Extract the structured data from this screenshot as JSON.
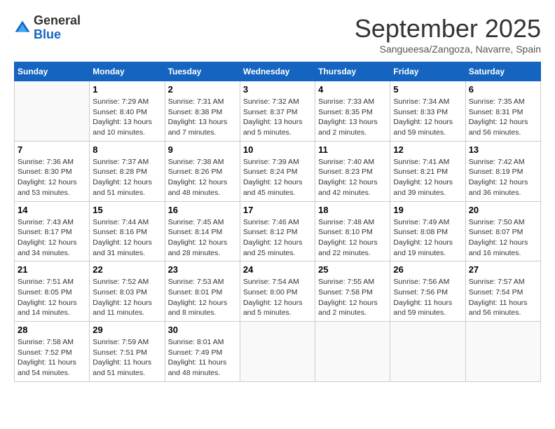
{
  "logo": {
    "general": "General",
    "blue": "Blue"
  },
  "header": {
    "month": "September 2025",
    "location": "Sangueesa/Zangoza, Navarre, Spain"
  },
  "days_of_week": [
    "Sunday",
    "Monday",
    "Tuesday",
    "Wednesday",
    "Thursday",
    "Friday",
    "Saturday"
  ],
  "weeks": [
    [
      {
        "day": "",
        "sunrise": "",
        "sunset": "",
        "daylight": ""
      },
      {
        "day": "1",
        "sunrise": "Sunrise: 7:29 AM",
        "sunset": "Sunset: 8:40 PM",
        "daylight": "Daylight: 13 hours and 10 minutes."
      },
      {
        "day": "2",
        "sunrise": "Sunrise: 7:31 AM",
        "sunset": "Sunset: 8:38 PM",
        "daylight": "Daylight: 13 hours and 7 minutes."
      },
      {
        "day": "3",
        "sunrise": "Sunrise: 7:32 AM",
        "sunset": "Sunset: 8:37 PM",
        "daylight": "Daylight: 13 hours and 5 minutes."
      },
      {
        "day": "4",
        "sunrise": "Sunrise: 7:33 AM",
        "sunset": "Sunset: 8:35 PM",
        "daylight": "Daylight: 13 hours and 2 minutes."
      },
      {
        "day": "5",
        "sunrise": "Sunrise: 7:34 AM",
        "sunset": "Sunset: 8:33 PM",
        "daylight": "Daylight: 12 hours and 59 minutes."
      },
      {
        "day": "6",
        "sunrise": "Sunrise: 7:35 AM",
        "sunset": "Sunset: 8:31 PM",
        "daylight": "Daylight: 12 hours and 56 minutes."
      }
    ],
    [
      {
        "day": "7",
        "sunrise": "Sunrise: 7:36 AM",
        "sunset": "Sunset: 8:30 PM",
        "daylight": "Daylight: 12 hours and 53 minutes."
      },
      {
        "day": "8",
        "sunrise": "Sunrise: 7:37 AM",
        "sunset": "Sunset: 8:28 PM",
        "daylight": "Daylight: 12 hours and 51 minutes."
      },
      {
        "day": "9",
        "sunrise": "Sunrise: 7:38 AM",
        "sunset": "Sunset: 8:26 PM",
        "daylight": "Daylight: 12 hours and 48 minutes."
      },
      {
        "day": "10",
        "sunrise": "Sunrise: 7:39 AM",
        "sunset": "Sunset: 8:24 PM",
        "daylight": "Daylight: 12 hours and 45 minutes."
      },
      {
        "day": "11",
        "sunrise": "Sunrise: 7:40 AM",
        "sunset": "Sunset: 8:23 PM",
        "daylight": "Daylight: 12 hours and 42 minutes."
      },
      {
        "day": "12",
        "sunrise": "Sunrise: 7:41 AM",
        "sunset": "Sunset: 8:21 PM",
        "daylight": "Daylight: 12 hours and 39 minutes."
      },
      {
        "day": "13",
        "sunrise": "Sunrise: 7:42 AM",
        "sunset": "Sunset: 8:19 PM",
        "daylight": "Daylight: 12 hours and 36 minutes."
      }
    ],
    [
      {
        "day": "14",
        "sunrise": "Sunrise: 7:43 AM",
        "sunset": "Sunset: 8:17 PM",
        "daylight": "Daylight: 12 hours and 34 minutes."
      },
      {
        "day": "15",
        "sunrise": "Sunrise: 7:44 AM",
        "sunset": "Sunset: 8:16 PM",
        "daylight": "Daylight: 12 hours and 31 minutes."
      },
      {
        "day": "16",
        "sunrise": "Sunrise: 7:45 AM",
        "sunset": "Sunset: 8:14 PM",
        "daylight": "Daylight: 12 hours and 28 minutes."
      },
      {
        "day": "17",
        "sunrise": "Sunrise: 7:46 AM",
        "sunset": "Sunset: 8:12 PM",
        "daylight": "Daylight: 12 hours and 25 minutes."
      },
      {
        "day": "18",
        "sunrise": "Sunrise: 7:48 AM",
        "sunset": "Sunset: 8:10 PM",
        "daylight": "Daylight: 12 hours and 22 minutes."
      },
      {
        "day": "19",
        "sunrise": "Sunrise: 7:49 AM",
        "sunset": "Sunset: 8:08 PM",
        "daylight": "Daylight: 12 hours and 19 minutes."
      },
      {
        "day": "20",
        "sunrise": "Sunrise: 7:50 AM",
        "sunset": "Sunset: 8:07 PM",
        "daylight": "Daylight: 12 hours and 16 minutes."
      }
    ],
    [
      {
        "day": "21",
        "sunrise": "Sunrise: 7:51 AM",
        "sunset": "Sunset: 8:05 PM",
        "daylight": "Daylight: 12 hours and 14 minutes."
      },
      {
        "day": "22",
        "sunrise": "Sunrise: 7:52 AM",
        "sunset": "Sunset: 8:03 PM",
        "daylight": "Daylight: 12 hours and 11 minutes."
      },
      {
        "day": "23",
        "sunrise": "Sunrise: 7:53 AM",
        "sunset": "Sunset: 8:01 PM",
        "daylight": "Daylight: 12 hours and 8 minutes."
      },
      {
        "day": "24",
        "sunrise": "Sunrise: 7:54 AM",
        "sunset": "Sunset: 8:00 PM",
        "daylight": "Daylight: 12 hours and 5 minutes."
      },
      {
        "day": "25",
        "sunrise": "Sunrise: 7:55 AM",
        "sunset": "Sunset: 7:58 PM",
        "daylight": "Daylight: 12 hours and 2 minutes."
      },
      {
        "day": "26",
        "sunrise": "Sunrise: 7:56 AM",
        "sunset": "Sunset: 7:56 PM",
        "daylight": "Daylight: 11 hours and 59 minutes."
      },
      {
        "day": "27",
        "sunrise": "Sunrise: 7:57 AM",
        "sunset": "Sunset: 7:54 PM",
        "daylight": "Daylight: 11 hours and 56 minutes."
      }
    ],
    [
      {
        "day": "28",
        "sunrise": "Sunrise: 7:58 AM",
        "sunset": "Sunset: 7:52 PM",
        "daylight": "Daylight: 11 hours and 54 minutes."
      },
      {
        "day": "29",
        "sunrise": "Sunrise: 7:59 AM",
        "sunset": "Sunset: 7:51 PM",
        "daylight": "Daylight: 11 hours and 51 minutes."
      },
      {
        "day": "30",
        "sunrise": "Sunrise: 8:01 AM",
        "sunset": "Sunset: 7:49 PM",
        "daylight": "Daylight: 11 hours and 48 minutes."
      },
      {
        "day": "",
        "sunrise": "",
        "sunset": "",
        "daylight": ""
      },
      {
        "day": "",
        "sunrise": "",
        "sunset": "",
        "daylight": ""
      },
      {
        "day": "",
        "sunrise": "",
        "sunset": "",
        "daylight": ""
      },
      {
        "day": "",
        "sunrise": "",
        "sunset": "",
        "daylight": ""
      }
    ]
  ]
}
